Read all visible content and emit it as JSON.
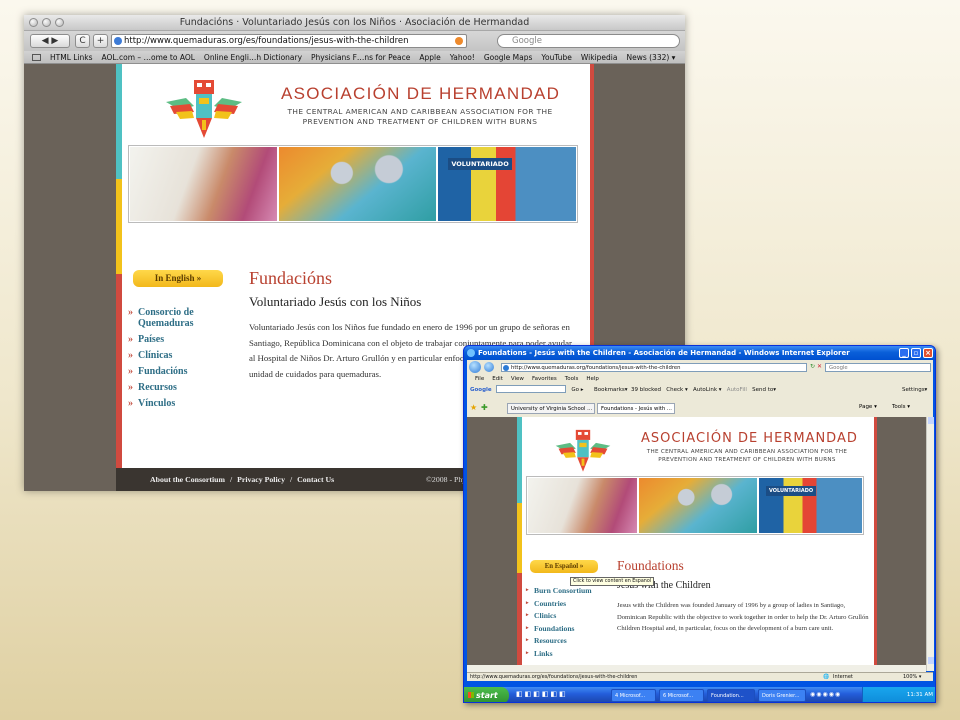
{
  "safari": {
    "window_title": "Fundacións · Voluntariado Jesús con los Niños · Asociación de Hermandad",
    "back_label": "◀ ▶",
    "reload_label": "C",
    "add_label": "+",
    "url": "http://www.quemaduras.org/es/foundations/jesus-with-the-children",
    "search_placeholder": "Google",
    "bookmarks": [
      "HTML Links",
      "AOL.com – …ome to AOL",
      "Online Engli…h Dictionary",
      "Physicians F…ns for Peace",
      "Apple",
      "Yahoo!",
      "Google Maps",
      "YouTube",
      "Wikipedia",
      "News (332) ▾"
    ]
  },
  "site_es": {
    "brand": "ASOCIACIÓN DE HERMANDAD",
    "tagline": "THE CENTRAL AMERICAN AND CARIBBEAN ASSOCIATION FOR THE PREVENTION AND TREATMENT OF CHILDREN WITH BURNS",
    "photo_label": "VOLUNTARIADO",
    "lang_button": "In English »",
    "nav": [
      "Consorcio de Quemaduras",
      "Países",
      "Clínicas",
      "Fundacións",
      "Recursos",
      "Vínculos"
    ],
    "heading": "Fundacións",
    "subheading": "Voluntariado Jesús con los Niños",
    "body": "Voluntariado Jesús con los Niños fue fundado en enero de 1996 por un grupo de señoras en Santiago, República Dominicana con el objeto de trabajar conjuntamente para poder ayudar al Hospital de Niños Dr. Arturo Grullón y en particular enfocarse en el desarrollo de la unidad de cuidados para quemaduras.",
    "footer_links": [
      "About the Consortium",
      "Privacy Policy",
      "Contact Us"
    ],
    "footer_copy": "©2008 - Phys"
  },
  "ie": {
    "window_title": "Foundations - Jesús with the Children - Asociación de Hermandad - Windows Internet Explorer",
    "url": "http://www.quemaduras.org/foundations/jesus-with-the-children",
    "search_placeholder": "Google",
    "menu": [
      "File",
      "Edit",
      "View",
      "Favorites",
      "Tools",
      "Help"
    ],
    "google_toolbar": [
      "Google",
      "Go ▸",
      "Bookmarks▾",
      "39 blocked",
      "Check ▾",
      "AutoLink ▾",
      "AutoFill",
      "Send to▾",
      "Settings▾"
    ],
    "tabs": [
      "University of Virginia School ...",
      "Foundations - Jesús with ..."
    ],
    "tab_tools": [
      "Page ▾",
      "Tools ▾"
    ],
    "status_url": "http://www.quemaduras.org/es/foundations/jesus-with-the-children",
    "status_zone": "Internet",
    "zoom": "100% ▾",
    "start": "start",
    "tasks": [
      "4 Microsof...",
      "6 Microsof...",
      "Foundation...",
      "Doris Grenier..."
    ],
    "clock": "11:31 AM"
  },
  "site_en": {
    "brand": "ASOCIACIÓN DE HERMANDAD",
    "tagline": "THE CENTRAL AMERICAN AND CARIBBEAN ASSOCIATION FOR THE PREVENTION AND TREATMENT OF CHILDREN WITH BURNS",
    "photo_label": "VOLUNTARIADO",
    "lang_button": "En Español »",
    "tooltip": "Click to view content en Espanol",
    "nav": [
      "Burn Consortium",
      "Countries",
      "Clinics",
      "Foundations",
      "Resources",
      "Links"
    ],
    "heading": "Foundations",
    "subheading": "Jesus with the Children",
    "body": "Jesus with the Children was founded January of 1996 by a group of ladies in Santiago, Dominican Republic with the objective to work together in order to help the Dr. Arturo Grullón Children Hospital and, in particular, focus on the development of a burn care unit."
  },
  "colors": {
    "brand_red": "#b8402f",
    "nav_teal": "#2e6e86",
    "button_gold": "#f2b81b",
    "strip_teal": "#4fc1c3",
    "strip_yellow": "#f2c21b",
    "strip_red": "#d04a3f"
  }
}
